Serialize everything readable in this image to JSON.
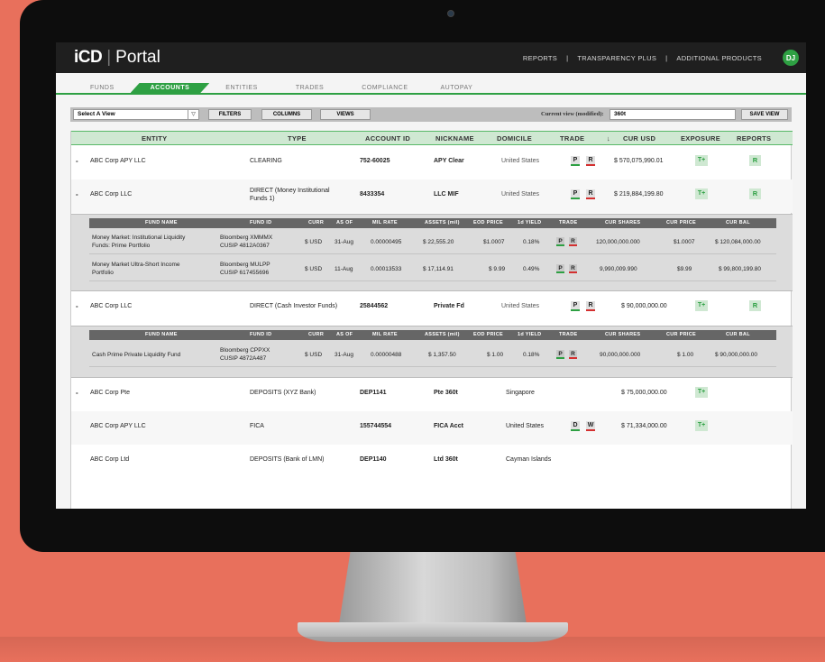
{
  "header": {
    "logo": "iCD",
    "logo_sep": "|",
    "app_name": "Portal",
    "nav": [
      "REPORTS",
      "|",
      "TRANSPARENCY PLUS",
      "|",
      "ADDITIONAL PRODUCTS"
    ],
    "avatar": "DJ"
  },
  "tabs": [
    "FUNDS",
    "ACCOUNTS",
    "ENTITIES",
    "TRADES",
    "COMPLIANCE",
    "AUTOPAY"
  ],
  "active_tab": "ACCOUNTS",
  "toolbar": {
    "select_view": "Select A View",
    "select_arrow": "▽",
    "filters": "FILTERS",
    "columns": "COLUMNS",
    "views": "VIEWS",
    "current_view_label": "Current view (modified):",
    "current_view_value": "360t",
    "save_view": "SAVE VIEW"
  },
  "columns": [
    "ENTITY",
    "TYPE",
    "ACCOUNT ID",
    "NICKNAME",
    "DOMICILE",
    "TRADE",
    "↓",
    "CUR USD",
    "EXPOSURE",
    "REPORTS"
  ],
  "rows": [
    {
      "exp": "-",
      "entity": "ABC Corp APY LLC",
      "type": "CLEARING",
      "type2": "",
      "account_id": "752-60025",
      "nickname": "APY Clear",
      "domicile": "United States",
      "t1": "P",
      "t2": "R",
      "cur_usd": "$ 570,075,990.01",
      "exposure": "T+",
      "reports": "R"
    },
    {
      "exp": "-",
      "entity": "ABC Corp LLC",
      "type": "DIRECT (Money Institutional",
      "type2": "Funds 1)",
      "account_id": "8433354",
      "nickname": "LLC MIF",
      "domicile": "United States",
      "t1": "P",
      "t2": "R",
      "cur_usd": "$ 219,884,199.80",
      "exposure": "T+",
      "reports": "R"
    },
    {
      "exp": "-",
      "entity": "ABC Corp LLC",
      "type": "DIRECT (Cash Investor Funds)",
      "type2": "",
      "account_id": "25844562",
      "nickname": "Private Fd",
      "domicile": "United States",
      "t1": "P",
      "t2": "R",
      "cur_usd": "$ 90,000,000.00",
      "exposure": "T+",
      "reports": "R"
    },
    {
      "exp": "-",
      "entity": "ABC Corp Pte",
      "type": "DEPOSITS (XYZ Bank)",
      "type2": "",
      "account_id": "DEP1141",
      "nickname": "Pte 360t",
      "domicile": "Singapore",
      "t1": "",
      "t2": "",
      "cur_usd": "$ 75,000,000.00",
      "exposure": "T+",
      "reports": ""
    },
    {
      "exp": "",
      "entity": "ABC Corp APY LLC",
      "type": "FICA",
      "type2": "",
      "account_id": "155744554",
      "nickname": "FICA Acct",
      "domicile": "United States",
      "t1": "D",
      "t2": "W",
      "cur_usd": "$ 71,334,000.00",
      "exposure": "T+",
      "reports": ""
    },
    {
      "exp": "",
      "entity": "ABC Corp Ltd",
      "type": "DEPOSITS (Bank of LMN)",
      "type2": "",
      "account_id": "DEP1140",
      "nickname": "Ltd 360t",
      "domicile": "Cayman Islands",
      "t1": "",
      "t2": "",
      "cur_usd": "",
      "exposure": "",
      "reports": ""
    }
  ],
  "sub_columns": [
    "FUND NAME",
    "FUND ID",
    "CURR",
    "AS OF",
    "MIL RATE",
    "ASSETS (mil)",
    "EOD PRICE",
    "1d YIELD",
    "TRADE",
    "CUR SHARES",
    "CUR PRICE",
    "CUR BAL"
  ],
  "sub1": [
    {
      "name1": "Money Market: Institutional Liquidity",
      "name2": "Funds: Prime Portfolio",
      "id1": "Bloomberg  XMMMX",
      "id2": "CUSIP  4812A0367",
      "curr": "$ USD",
      "as_of": "31-Aug",
      "mil_rate": "0.00000495",
      "assets": "$ 22,555.20",
      "eod": "$1.0007",
      "yield": "0.18%",
      "t1": "P",
      "t2": "R",
      "shares": "120,000,000.000",
      "price": "$1.0007",
      "bal": "$ 120,084,000.00"
    },
    {
      "name1": "Money Market Ultra-Short Income",
      "name2": "Portfolio",
      "id1": "Bloomberg  MULPP",
      "id2": "CUSIP  617455696",
      "curr": "$ USD",
      "as_of": "11-Aug",
      "mil_rate": "0.00013533",
      "assets": "$ 17,114.91",
      "eod": "$ 9.99",
      "yield": "0.49%",
      "t1": "P",
      "t2": "R",
      "shares": "9,990,009.990",
      "price": "$9.99",
      "bal": "$ 99,800,199.80"
    }
  ],
  "sub2": [
    {
      "name1": "Cash Prime Private Liquidity Fund",
      "name2": "",
      "id1": "Bloomberg  CPPXX",
      "id2": "CUSIP  4872A487",
      "curr": "$ USD",
      "as_of": "31-Aug",
      "mil_rate": "0.00000488",
      "assets": "$ 1,357.50",
      "eod": "$ 1.00",
      "yield": "0.18%",
      "t1": "P",
      "t2": "R",
      "shares": "90,000,000.000",
      "price": "$ 1.00",
      "bal": "$ 90,000,000.00"
    }
  ],
  "colors": {
    "accent": "#2ea043",
    "header_bg": "#cfe8d2",
    "alert_red": "#d43030",
    "background": "#e8705c"
  }
}
